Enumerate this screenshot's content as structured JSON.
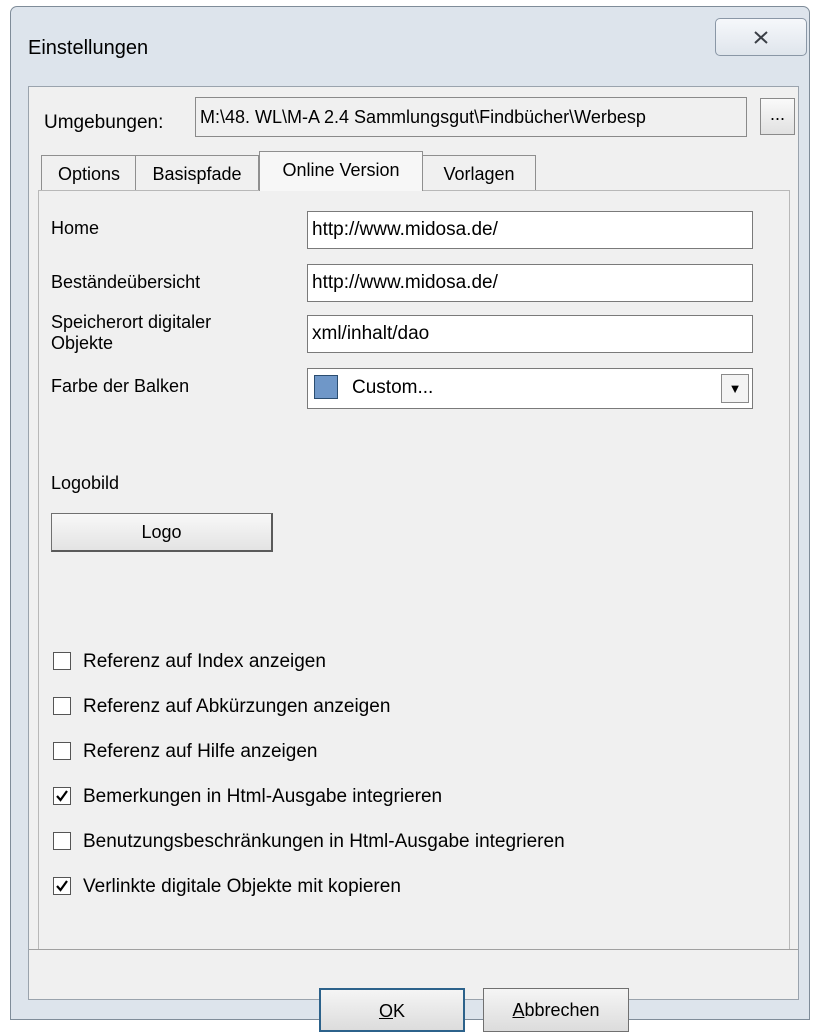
{
  "window": {
    "title": "Einstellungen",
    "close_icon": "close-icon"
  },
  "environment": {
    "label": "Umgebungen:",
    "path": "M:\\48. WL\\M-A 2.4 Sammlungsgut\\Findbücher\\Werbesp",
    "browse_label": "..."
  },
  "tabs": [
    {
      "label": "Options",
      "active": false
    },
    {
      "label": "Basispfade",
      "active": false
    },
    {
      "label": "Online Version",
      "active": true
    },
    {
      "label": "Vorlagen",
      "active": false
    }
  ],
  "online": {
    "home_label": "Home",
    "home_value": "http://www.midosa.de/",
    "overview_label": "Beständeübersicht",
    "overview_value": "http://www.midosa.de/",
    "storage_label_line1": "Speicherort digitaler",
    "storage_label_line2": "Objekte",
    "storage_value": "xml/inhalt/dao",
    "bar_color_label": "Farbe der Balken",
    "bar_color_value": "Custom...",
    "bar_color_swatch": "#6f97c8",
    "logo_label": "Logobild",
    "logo_button": "Logo"
  },
  "checkboxes": [
    {
      "label": "Referenz auf Index anzeigen",
      "checked": false
    },
    {
      "label": "Referenz auf Abkürzungen anzeigen",
      "checked": false
    },
    {
      "label": "Referenz auf Hilfe anzeigen",
      "checked": false
    },
    {
      "label": "Bemerkungen in Html-Ausgabe integrieren",
      "checked": true
    },
    {
      "label": "Benutzungsbeschränkungen in Html-Ausgabe integrieren",
      "checked": false
    },
    {
      "label": "Verlinkte digitale Objekte mit kopieren",
      "checked": true
    }
  ],
  "buttons": {
    "ok": "OK",
    "cancel": "Abbrechen"
  }
}
